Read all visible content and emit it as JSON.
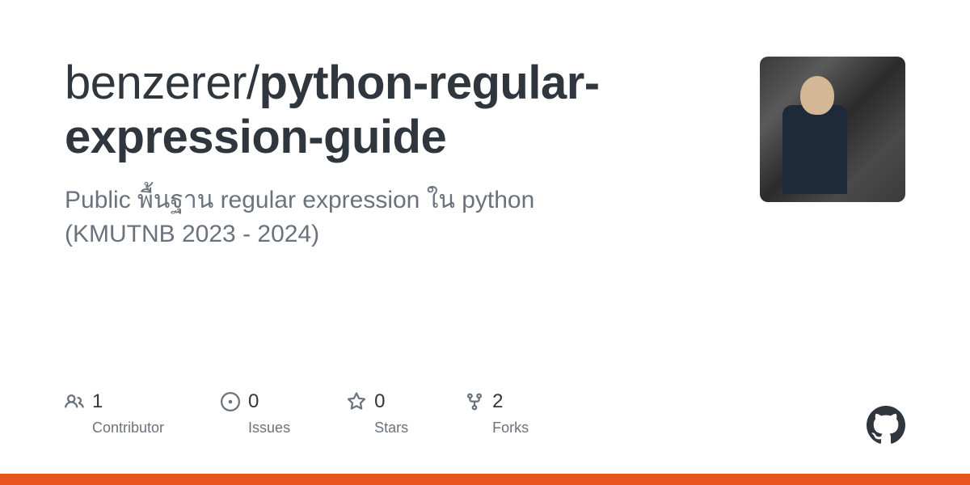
{
  "repo": {
    "owner": "benzerer",
    "name": "python-regular-expression-guide",
    "description": "Public พื้นฐาน regular expression ใน python (KMUTNB 2023 - 2024)"
  },
  "stats": {
    "contributors": {
      "value": "1",
      "label": "Contributor"
    },
    "issues": {
      "value": "0",
      "label": "Issues"
    },
    "stars": {
      "value": "0",
      "label": "Stars"
    },
    "forks": {
      "value": "2",
      "label": "Forks"
    }
  },
  "accent_color": "#e8541e"
}
